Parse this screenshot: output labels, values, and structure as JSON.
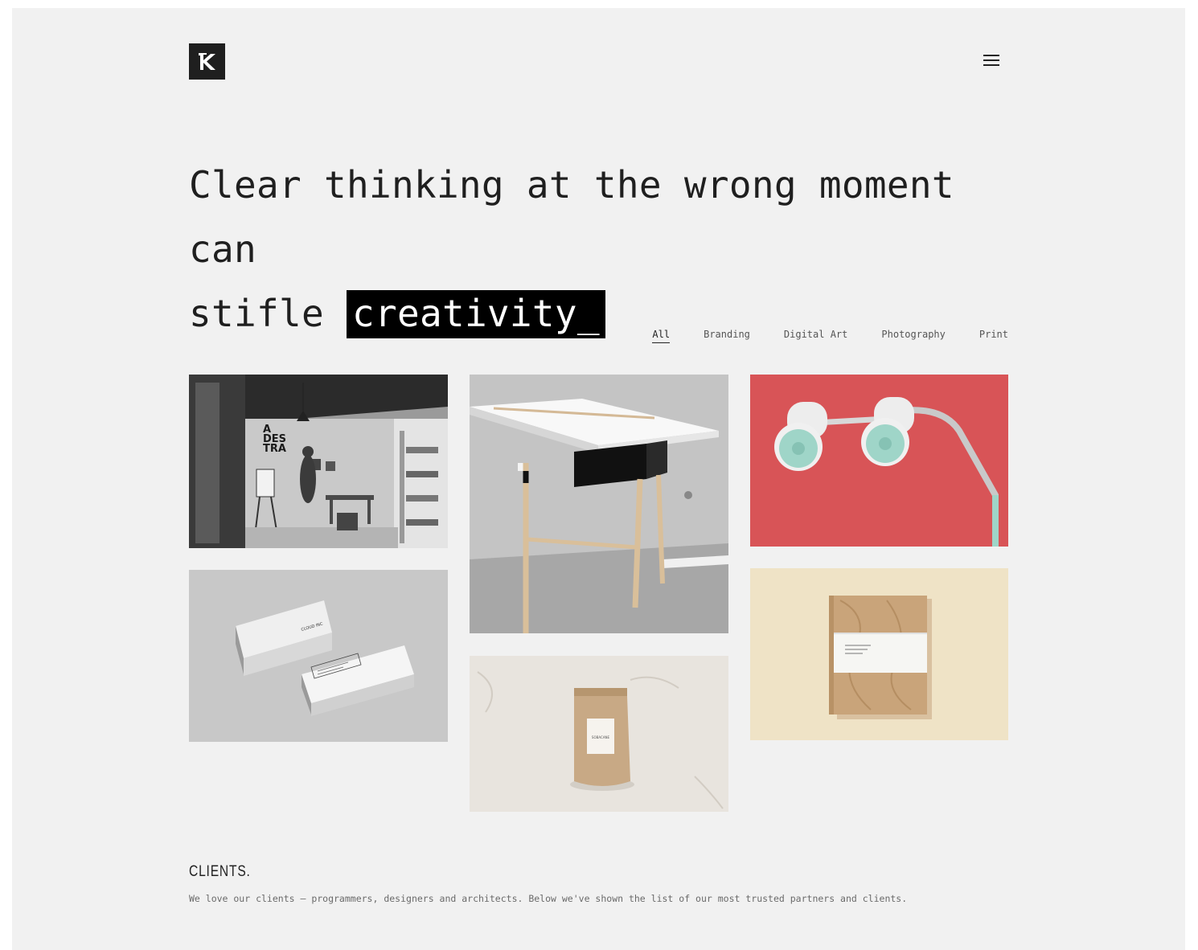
{
  "header": {
    "logo_icon": "k-logo-icon",
    "menu_icon": "hamburger-menu-icon"
  },
  "hero": {
    "line1": "Clear thinking at the wrong moment can",
    "line2_prefix": "stifle",
    "highlight": "creativity_"
  },
  "filters": {
    "items": [
      "All",
      "Branding",
      "Digital Art",
      "Photography",
      "Print"
    ],
    "active": "All"
  },
  "portfolio": {
    "tiles": [
      {
        "name": "studio-office-photo",
        "card_text": "A DES TRA"
      },
      {
        "name": "business-cards-mockup",
        "card_text": "CLOUD INC"
      },
      {
        "name": "white-table-photo"
      },
      {
        "name": "coffee-pouch-mockup",
        "card_text": "SOBACANE"
      },
      {
        "name": "lamps-on-red-photo"
      },
      {
        "name": "wooden-notebook-mockup"
      }
    ]
  },
  "clients": {
    "title": "CLIENTS.",
    "description": "We love our clients — programmers, designers and architects. Below we've shown the list of our most trusted partners and clients."
  },
  "colors": {
    "background": "#f1f1f1",
    "text": "#1f1f1f",
    "highlight_bg": "#000000",
    "red_tile": "#d85457",
    "mint": "#9fd5c8",
    "cream": "#efe3c6"
  }
}
